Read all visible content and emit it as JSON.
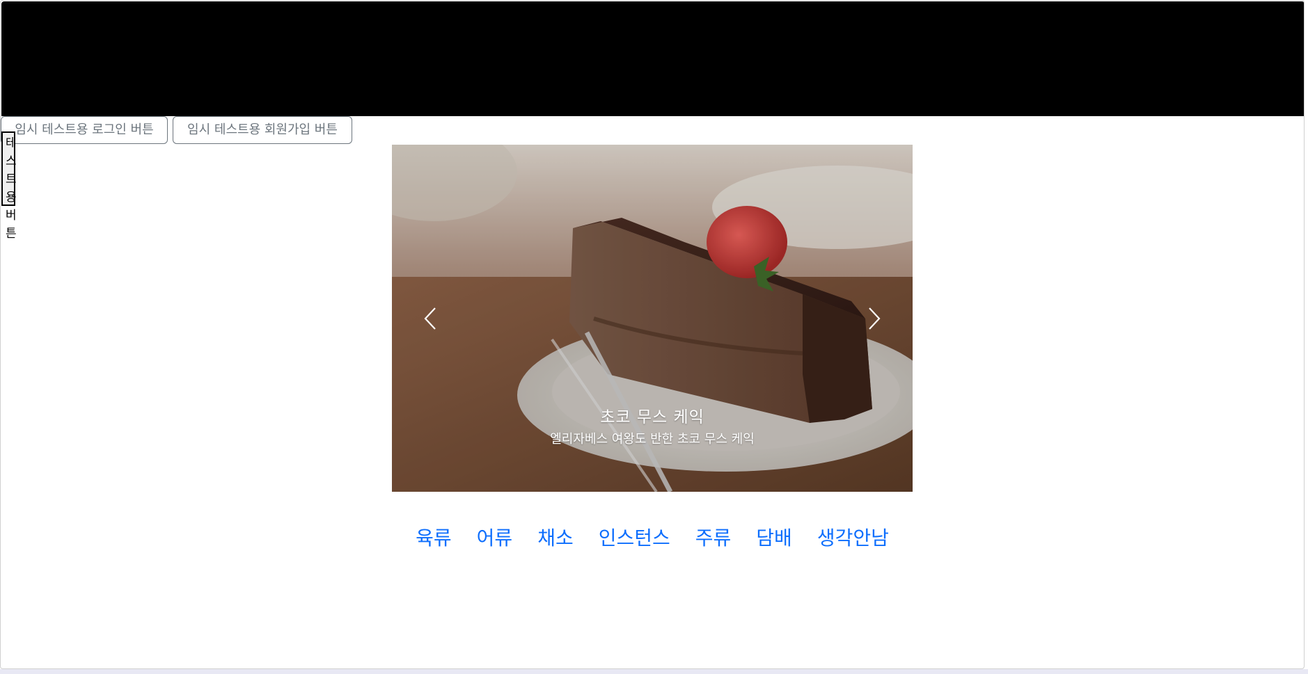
{
  "header": {
    "background": "#000000"
  },
  "temp_buttons": {
    "login_label": "임시 테스트용 로그인 버튼",
    "signup_label": "임시 테스트용 회원가입 버튼"
  },
  "test_button": {
    "label": "테스트용버튼"
  },
  "carousel": {
    "slide": {
      "title": "초코 무스 케익",
      "description": "엘리자베스 여왕도 반한 초코 무스 케익"
    },
    "prev_icon": "chevron-left-icon",
    "next_icon": "chevron-right-icon"
  },
  "categories": [
    {
      "label": "육류"
    },
    {
      "label": "어류"
    },
    {
      "label": "채소"
    },
    {
      "label": "인스턴스"
    },
    {
      "label": "주류"
    },
    {
      "label": "담배"
    },
    {
      "label": "생각안남"
    }
  ],
  "colors": {
    "link": "#0d6efd",
    "outline_button": "#6c757d"
  }
}
